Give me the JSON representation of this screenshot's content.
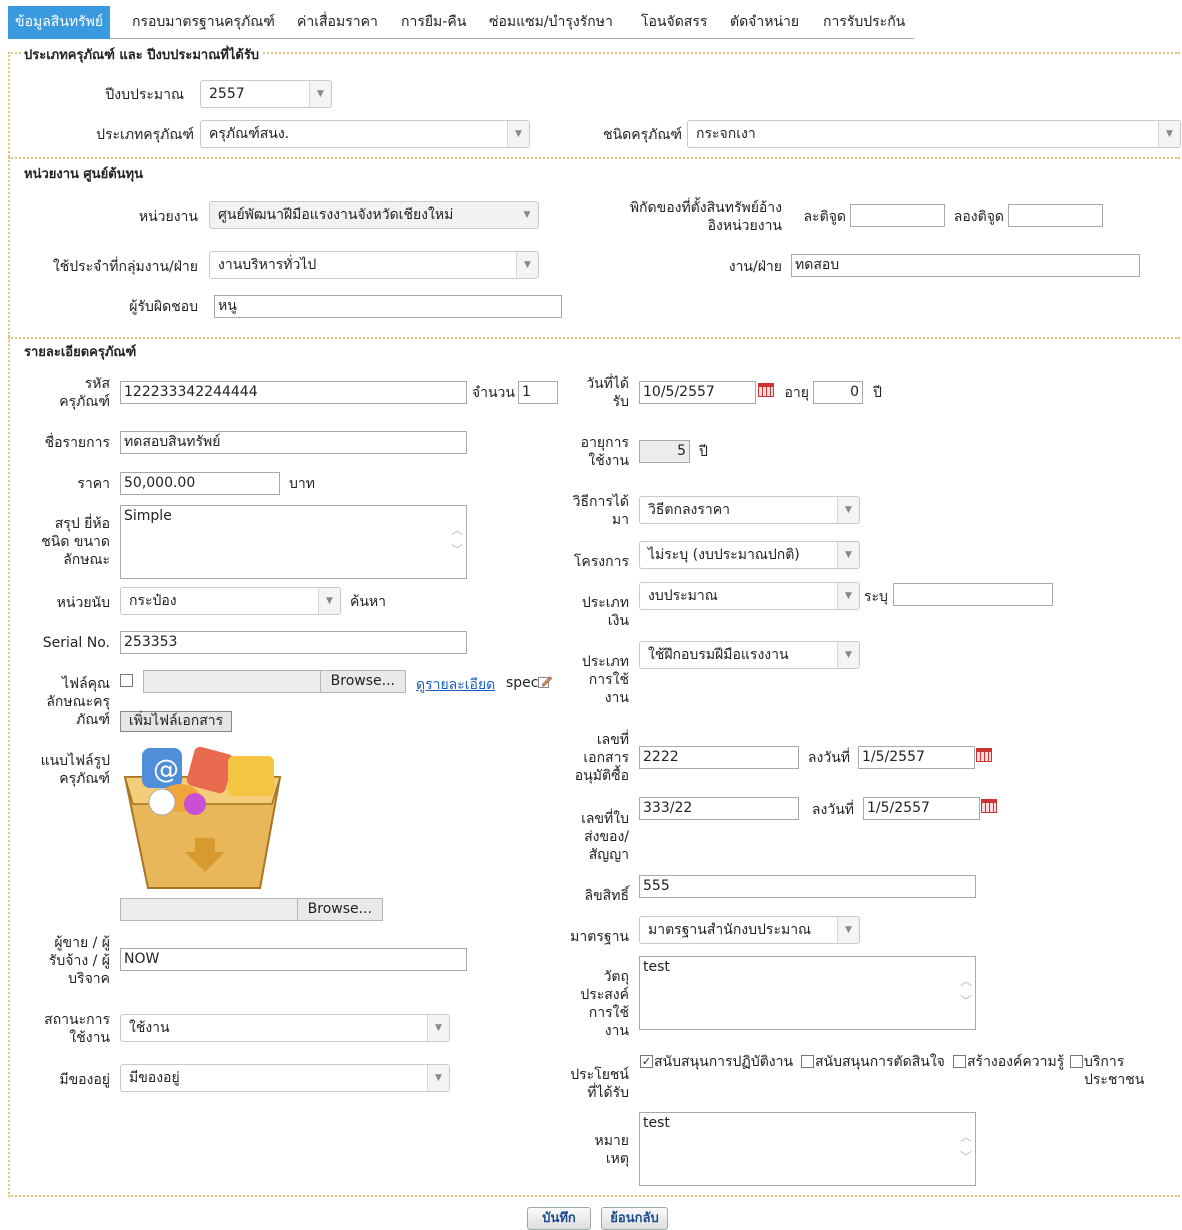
{
  "tabs": [
    {
      "label": "ข้อมูลสินทรัพย์",
      "active": true
    },
    {
      "label": "กรอบมาตรฐานครุภัณฑ์"
    },
    {
      "label": "ค่าเสื่อมราคา"
    },
    {
      "label": "การยืม-คืน"
    },
    {
      "label": "ซ่อมแซม/บำรุงรักษา"
    },
    {
      "label": "โอนจัดสรร"
    },
    {
      "label": "ตัดจำหน่าย"
    },
    {
      "label": "การรับประกัน"
    }
  ],
  "section1": {
    "legend": "ประเภทครุภัณฑ์ และ ปีงบประมาณที่ได้รับ",
    "fiscal_year_label": "ปีงบประมาณ",
    "fiscal_year": "2557",
    "asset_type_label": "ประเภทครุภัณฑ์",
    "asset_type": "ครุภัณฑ์สนง.",
    "asset_kind_label": "ชนิดครุภัณฑ์",
    "asset_kind": "กระจกเงา"
  },
  "section2": {
    "legend": "หน่วยงาน ศูนย์ต้นทุน",
    "agency_label": "หน่วยงาน",
    "agency": "ศูนย์พัฒนาฝีมือแรงงานจังหวัดเชียงใหม่",
    "group_label": "ใช้ประจำที่กลุ่มงาน/ฝ่าย",
    "group": "งานบริหารทั่วไป",
    "owner_label": "ผู้รับผิดชอบ",
    "owner": "หนู",
    "coords_label_1": "พิกัดของที่ตั้งสินทรัพย์อ้าง",
    "coords_label_2": "อิงหน่วยงาน",
    "lat_label": "ละติจูด",
    "lat": "",
    "lng_label": "ลองติจูด",
    "lng": "",
    "unit_label": "งาน/ฝ่าย",
    "unit": "ทดสอบ"
  },
  "section3": {
    "legend": "รายละเอียดครุภัณฑ์",
    "code_label_1": "รหัส",
    "code_label_2": "ครุภัณฑ์",
    "code": "122233342244444",
    "qty_label": "จำนวน",
    "qty": "1",
    "name_label": "ชื่อรายการ",
    "name": "ทดสอบสินทรัพย์",
    "price_label": "ราคา",
    "price": "50,000.00",
    "price_unit": "บาท",
    "desc_label_1": "สรุป ยี่ห้อ",
    "desc_label_2": "ชนิด ขนาด",
    "desc_label_3": "ลักษณะ",
    "desc": "Simple",
    "unit_count_label": "หน่วยนับ",
    "unit_count": "กระป๋อง",
    "search_label": "ค้นหา",
    "serial_label": "Serial No.",
    "serial": "253353",
    "spec_label_1": "ไฟล์คุณ",
    "spec_label_2": "ลักษณะครุ",
    "spec_label_3": "ภัณฑ์",
    "browse_label": "Browse...",
    "detail_link": "ดูรายละเอียด",
    "spec_text": "spec",
    "add_file_label": "เพิ่มไฟล์เอกสาร",
    "photo_label_1": "แนบไฟล์รูป",
    "photo_label_2": "ครุภัณฑ์",
    "vendor_label_1": "ผู้ขาย / ผู้",
    "vendor_label_2": "รับจ้าง / ผู้",
    "vendor_label_3": "บริจาค",
    "vendor": "NOW",
    "status_label_1": "สถานะการ",
    "status_label_2": "ใช้งาน",
    "status": "ใช้งาน",
    "exists_label": "มีของอยู่",
    "exists": "มีของอยู่",
    "date_label_1": "วันที่ได้",
    "date_label_2": "รับ",
    "date": "10/5/2557",
    "age_label": "อายุ",
    "age": "0",
    "year_unit": "ปี",
    "life_label_1": "อายุการ",
    "life_label_2": "ใช้งาน",
    "life": "5",
    "method_label_1": "วิธีการได้",
    "method_label_2": "มา",
    "method": "วิธีตกลงราคา",
    "project_label": "โครงการ",
    "project": "ไม่ระบุ (งบประมาณปกติ)",
    "money_label_1": "ประเภท",
    "money_label_2": "เงิน",
    "money": "งบประมาณ",
    "specify_label": "ระบุ",
    "specify": "",
    "use_label_1": "ประเภท",
    "use_label_2": "การใช้",
    "use_label_3": "งาน",
    "use": "ใช้ฝึกอบรมฝีมือแรงงาน",
    "approve_label_1": "เลขที่",
    "approve_label_2": "เอกสาร",
    "approve_label_3": "อนุมัติซื้อ",
    "approve_no": "2222",
    "signed_label": "ลงวันที่",
    "approve_date": "1/5/2557",
    "contract_label_1": "เลขที่ใบ",
    "contract_label_2": "ส่งของ/",
    "contract_label_3": "สัญญา",
    "contract_no": "333/22",
    "contract_date": "1/5/2557",
    "rights_label": "ลิขสิทธิ์",
    "rights": "555",
    "standard_label": "มาตรฐาน",
    "standard": "มาตรฐานสำนักงบประมาณ",
    "purpose_label_1": "วัตถุ",
    "purpose_label_2": "ประสงค์",
    "purpose_label_3": "การใช้",
    "purpose_label_4": "งาน",
    "purpose": "test",
    "benefit_label_1": "ประโยชน์",
    "benefit_label_2": "ที่ได้รับ",
    "benefits": [
      {
        "label": "สนับสนุนการปฏิบัติงาน",
        "checked": true
      },
      {
        "label": "สนับสนุนการตัดสินใจ",
        "checked": false
      },
      {
        "label": "สร้างองค์ความรู้",
        "checked": false
      },
      {
        "label": "บริการประชาชน",
        "checked": false
      }
    ],
    "note_label_1": "หมาย",
    "note_label_2": "เหตุ",
    "note": "test"
  },
  "buttons": {
    "save": "บันทึก",
    "back": "ย้อนกลับ"
  }
}
